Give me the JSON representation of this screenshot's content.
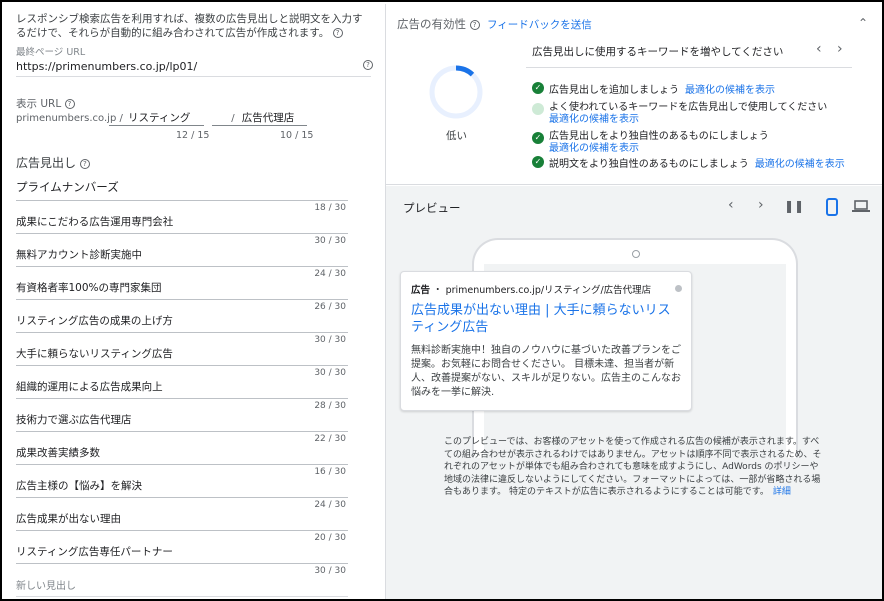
{
  "intro": {
    "text": "レスポンシブ検索広告を利用すれば、複数の広告見出しと説明文を入力するだけで、それらが自動的に組み合わされて広告が作成されます。"
  },
  "final_url": {
    "label": "最終ページ URL",
    "value": "https://primenumbers.co.jp/lp01/"
  },
  "display_url": {
    "label": "表示 URL",
    "domain": "primenumbers.co.jp /",
    "path1": "リスティング",
    "separator": "/",
    "path2": "広告代理店",
    "path1_count": "12 / 15",
    "path2_count": "10 / 15"
  },
  "headlines": {
    "title": "広告見出し",
    "items": [
      {
        "text": "プライムナンバーズ",
        "count": "18 / 30"
      },
      {
        "text": "成果にこだわる広告運用専門会社",
        "count": "30 / 30"
      },
      {
        "text": "無料アカウント診断実施中",
        "count": "24 / 30"
      },
      {
        "text": "有資格者率100%の専門家集団",
        "count": "26 / 30"
      },
      {
        "text": "リスティング広告の成果の上げ方",
        "count": "30 / 30"
      },
      {
        "text": "大手に頼らないリスティング広告",
        "count": "30 / 30"
      },
      {
        "text": "組織的運用による広告成果向上",
        "count": "28 / 30"
      },
      {
        "text": "技術力で選ぶ広告代理店",
        "count": "22 / 30"
      },
      {
        "text": "成果改善実績多数",
        "count": "16 / 30"
      },
      {
        "text": "広告主様の【悩み】を解決",
        "count": "24 / 30"
      },
      {
        "text": "広告成果が出ない理由",
        "count": "20 / 30"
      },
      {
        "text": "リスティング広告専任パートナー",
        "count": "30 / 30"
      }
    ],
    "new_placeholder": "新しい見出し"
  },
  "ad_strength": {
    "title": "広告の有効性",
    "feedback_link": "フィードバックを送信",
    "level": "低い",
    "progress": 0.12,
    "accent": "#1a73e8",
    "suggestion_header": "広告見出しに使用するキーワードを増やしてください",
    "suggestions": [
      {
        "text": "広告見出しを追加しましょう",
        "link": "最適化の候補を表示",
        "done": true
      },
      {
        "text": "よく使われているキーワードを広告見出しで使用してください",
        "link": "最適化の候補を表示",
        "done": false
      },
      {
        "text": "広告見出しをより独自性のあるものにしましょう",
        "link": "最適化の候補を表示",
        "done": true
      },
      {
        "text": "説明文をより独自性のあるものにしましょう",
        "link": "最適化の候補を表示",
        "done": true
      }
    ]
  },
  "preview": {
    "title": "プレビュー",
    "ad_badge": "広告",
    "ad_url": "・ primenumbers.co.jp/リスティング/広告代理店",
    "ad_headline": "広告成果が出ない理由 | 大手に頼らないリスティング広告",
    "ad_description": "無料診断実施中！独自のノウハウに基づいた改善プランをご提案。お気軽にお問合せください。 目標未達、担当者が新人、改善提案がない、スキルが足りない。広告主のこんなお悩みを一挙に解決.",
    "notice": "このプレビューでは、お客様のアセットを使って作成される広告の候補が表示されます。すべての組み合わせが表示されるわけではありません。アセットは順序不同で表示されるため、それぞれのアセットが単体でも組み合わされても意味を成すようにし、AdWords のポリシーや地域の法律に違反しないようにしてください。フォーマットによっては、一部が省略される場合もあります。 特定のテキストが広告に表示されるようにすることは可能です。",
    "notice_link": "詳細"
  }
}
